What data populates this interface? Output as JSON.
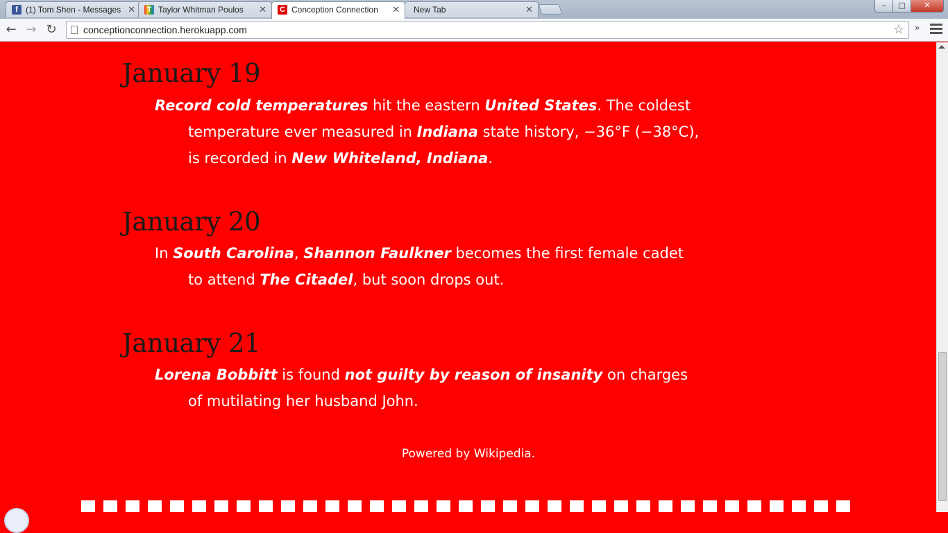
{
  "browser": {
    "tabs": [
      {
        "title": "(1) Tom Shen - Messages",
        "icon": "facebook-icon",
        "color": "#3b5998"
      },
      {
        "title": "Taylor Whitman Poulos",
        "icon": "t-colorful-icon",
        "color": "#2e9e4f"
      },
      {
        "title": "Conception Connection",
        "icon": "c-logo-icon",
        "color": "#e00000"
      },
      {
        "title": "New Tab",
        "icon": "",
        "color": ""
      }
    ],
    "url": "conceptionconnection.herokuapp.com",
    "window_buttons": {
      "minimize": "–",
      "maximize": "□",
      "close": "✕"
    }
  },
  "events": [
    {
      "date": "January 19",
      "parts": [
        {
          "b": "Record cold temperatures"
        },
        {
          "t": " hit the eastern "
        },
        {
          "b": "United States"
        },
        {
          "t": ". The coldest temperature ever measured in "
        },
        {
          "b": "Indiana"
        },
        {
          "t": " state history, −36°F (−38°C), is recorded in "
        },
        {
          "b": "New Whiteland, Indiana"
        },
        {
          "t": "."
        }
      ]
    },
    {
      "date": "January 20",
      "parts": [
        {
          "t": "In "
        },
        {
          "b": "South Carolina"
        },
        {
          "t": ", "
        },
        {
          "b": "Shannon Faulkner"
        },
        {
          "t": " becomes the first female cadet to attend "
        },
        {
          "b": "The Citadel"
        },
        {
          "t": ", but soon drops out."
        }
      ]
    },
    {
      "date": "January 21",
      "parts": [
        {
          "b": "Lorena Bobbitt"
        },
        {
          "t": " is found "
        },
        {
          "b": "not guilty by reason of insanity"
        },
        {
          "t": " on charges of mutilating her husband John."
        }
      ]
    }
  ],
  "footer": "Powered by Wikipedia.",
  "colors": {
    "page_background": "#ff0000",
    "date_text": "#1a1a1a",
    "body_text": "#ffffff"
  }
}
